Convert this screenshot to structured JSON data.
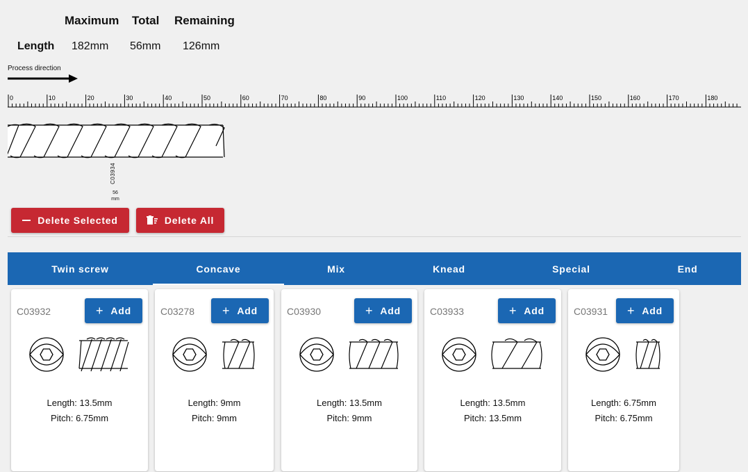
{
  "summary": {
    "headers": [
      "Maximum",
      "Total",
      "Remaining"
    ],
    "row_label": "Length",
    "maximum": "182mm",
    "total": "56mm",
    "remaining": "126mm"
  },
  "process_direction": "Process direction",
  "ruler": {
    "labels": [
      "0",
      "10",
      "20",
      "30",
      "40",
      "50",
      "60",
      "70",
      "80",
      "90",
      "100",
      "110",
      "120",
      "130",
      "140",
      "150",
      "160",
      "170",
      "180"
    ]
  },
  "assembly": {
    "segment_code": "C03934",
    "segment_length": "56",
    "segment_unit": "mm"
  },
  "actions": {
    "delete_selected": "Delete Selected",
    "delete_all": "Delete All"
  },
  "tabs": [
    {
      "label": "Twin screw",
      "active": false
    },
    {
      "label": "Concave",
      "active": true
    },
    {
      "label": "Mix",
      "active": false
    },
    {
      "label": "Knead",
      "active": false
    },
    {
      "label": "Special",
      "active": false
    },
    {
      "label": "End",
      "active": false
    }
  ],
  "add_label": "Add",
  "elements": [
    {
      "code": "C03932",
      "length": "Length: 13.5mm",
      "pitch": "Pitch: 6.75mm"
    },
    {
      "code": "C03278",
      "length": "Length: 9mm",
      "pitch": "Pitch: 9mm"
    },
    {
      "code": "C03930",
      "length": "Length: 13.5mm",
      "pitch": "Pitch: 9mm"
    },
    {
      "code": "C03933",
      "length": "Length: 13.5mm",
      "pitch": "Pitch: 13.5mm"
    },
    {
      "code": "C03931",
      "length": "Length: 6.75mm",
      "pitch": "Pitch: 6.75mm"
    }
  ],
  "colors": {
    "primary": "#1b67b3",
    "danger": "#c62832",
    "background": "#f0f0f0"
  }
}
